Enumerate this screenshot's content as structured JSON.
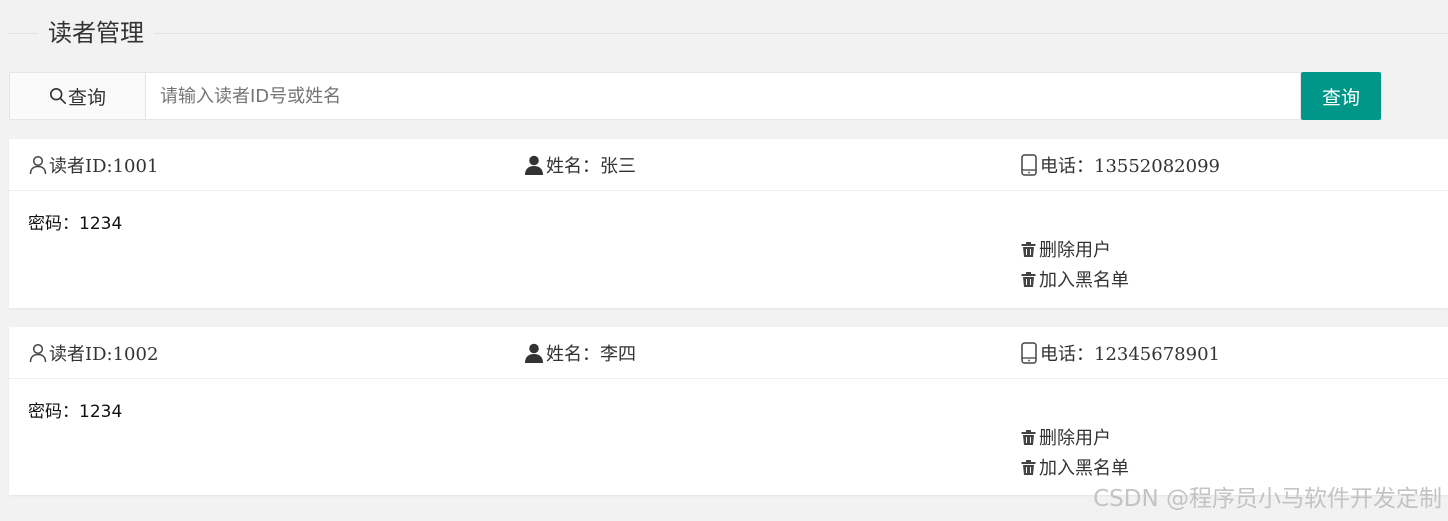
{
  "page": {
    "title": "读者管理"
  },
  "search": {
    "addon_label": "查询",
    "placeholder": "请输入读者ID号或姓名",
    "value": "",
    "button_label": "查询"
  },
  "readers": [
    {
      "id_text": "读者ID:1001",
      "name_text": "姓名：张三",
      "phone_text": "电话：13552082099",
      "password_text": "密码：1234",
      "delete_label": "删除用户",
      "blacklist_label": "加入黑名单"
    },
    {
      "id_text": "读者ID:1002",
      "name_text": "姓名：李四",
      "phone_text": "电话：12345678901",
      "password_text": "密码：1234",
      "delete_label": "删除用户",
      "blacklist_label": "加入黑名单"
    }
  ],
  "watermark": "CSDN @程序员小马软件开发定制",
  "colors": {
    "accent": "#009688",
    "background": "#f2f2f2",
    "card": "#ffffff"
  },
  "icons": {
    "search": "search-icon",
    "reader": "user-outline-icon",
    "name": "user-solid-icon",
    "phone": "mobile-phone-icon",
    "delete": "trash-icon"
  }
}
